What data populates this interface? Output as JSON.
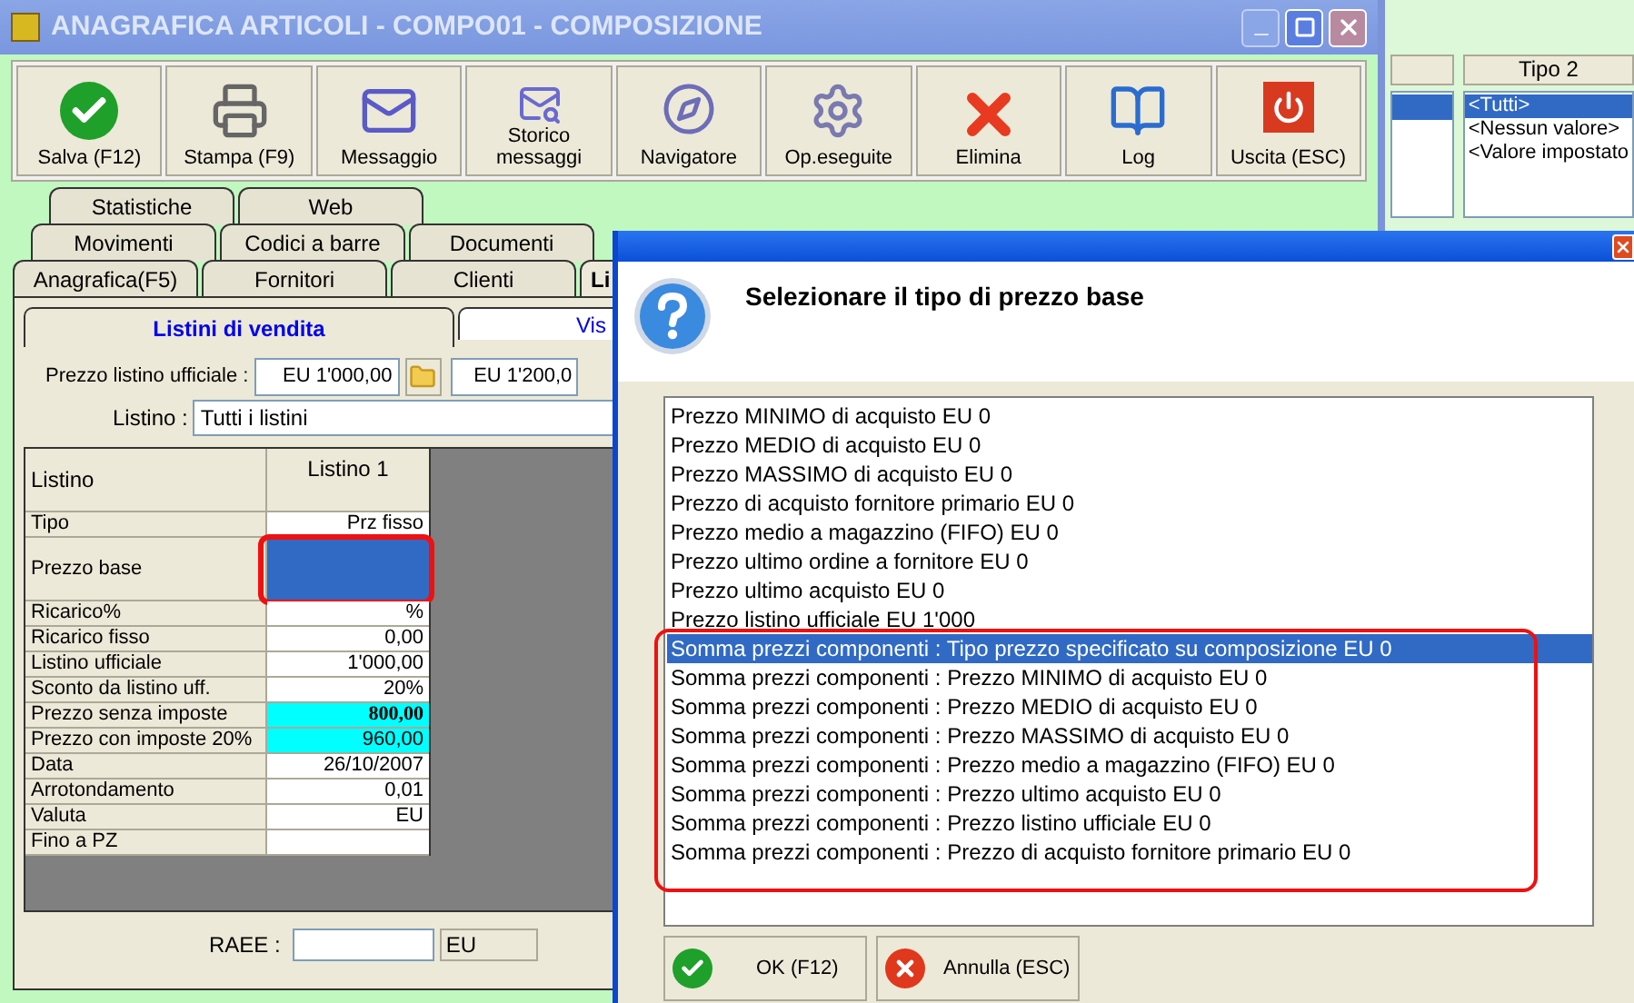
{
  "main_window": {
    "title": "ANAGRAFICA ARTICOLI - COMPO01 - COMPOSIZIONE"
  },
  "toolbar": [
    {
      "label": "Salva (F12)",
      "kind": "save"
    },
    {
      "label": "Stampa (F9)",
      "kind": "print"
    },
    {
      "label": "Messaggio",
      "kind": "message"
    },
    {
      "label": "Storico messaggi",
      "kind": "history"
    },
    {
      "label": "Navigatore",
      "kind": "navigator"
    },
    {
      "label": "Op.eseguite",
      "kind": "operations"
    },
    {
      "label": "Elimina",
      "kind": "delete"
    },
    {
      "label": "Log",
      "kind": "log"
    },
    {
      "label": "Uscita (ESC)",
      "kind": "exit"
    }
  ],
  "tab_rows": [
    {
      "tabs": [
        {
          "label": "Statistiche",
          "selected": false
        },
        {
          "label": "Web",
          "selected": false
        }
      ]
    },
    {
      "tabs": [
        {
          "label": "Movimenti",
          "selected": false
        },
        {
          "label": "Codici a barre",
          "selected": false
        },
        {
          "label": "Documenti",
          "selected": false
        }
      ]
    },
    {
      "tabs": [
        {
          "label": "Anagrafica(F5)",
          "selected": false
        },
        {
          "label": "Fornitori",
          "selected": false
        },
        {
          "label": "Clienti",
          "selected": false
        },
        {
          "label": "Li",
          "selected": true
        }
      ]
    }
  ],
  "subtabs": [
    {
      "label": "Listini di vendita",
      "selected": true
    },
    {
      "label": "Vis",
      "selected": false
    }
  ],
  "price_field": {
    "label": "Prezzo listino ufficiale :",
    "value": "EU 1'000,00",
    "value_2": "EU 1'200,0"
  },
  "listino_field": {
    "label": "Listino :",
    "value": "Tutti i listini"
  },
  "grid": {
    "header_label": "Listino",
    "column": "Listino 1",
    "rows": [
      {
        "label": "Tipo",
        "value": "Prz fisso",
        "kind": "text"
      },
      {
        "label": "Prezzo base",
        "value": "",
        "kind": "selected"
      },
      {
        "label": "Ricarico%",
        "value": "%",
        "kind": "text"
      },
      {
        "label": "Ricarico fisso",
        "value": "0,00",
        "kind": "text"
      },
      {
        "label": "Listino ufficiale",
        "value": "1'000,00",
        "kind": "text"
      },
      {
        "label": "Sconto da listino uff.",
        "value": "20%",
        "kind": "text"
      },
      {
        "label": "Prezzo senza imposte",
        "value": "800,00",
        "kind": "total_bold"
      },
      {
        "label": "Prezzo con imposte 20%",
        "value": "960,00",
        "kind": "total"
      },
      {
        "label": "Data",
        "value": "26/10/2007",
        "kind": "text"
      },
      {
        "label": "Arrotondamento",
        "value": "0,01",
        "kind": "text"
      },
      {
        "label": "Valuta",
        "value": "EU",
        "kind": "text"
      },
      {
        "label": "Fino a PZ",
        "value": "",
        "kind": "text"
      }
    ]
  },
  "raee": {
    "label": "RAEE :",
    "currency": "EU"
  },
  "background_window": {
    "column_1_selected": true,
    "column_2": "Tipo 2",
    "options": [
      {
        "label": "<Tutti>",
        "selected": true
      },
      {
        "label": "<Nessun valore>",
        "selected": false
      },
      {
        "label": "<Valore impostato",
        "selected": false
      }
    ]
  },
  "dialog": {
    "title": "Selezionare il tipo di prezzo base",
    "options": [
      {
        "label": "Prezzo MINIMO di acquisto EU 0",
        "kind": "own",
        "selected": false
      },
      {
        "label": "Prezzo MEDIO di acquisto EU 0",
        "kind": "own",
        "selected": false
      },
      {
        "label": "Prezzo MASSIMO di acquisto EU 0",
        "kind": "own",
        "selected": false
      },
      {
        "label": "Prezzo di acquisto fornitore primario EU 0",
        "kind": "own",
        "selected": false
      },
      {
        "label": "Prezzo medio a magazzino (FIFO) EU 0",
        "kind": "own",
        "selected": false
      },
      {
        "label": "Prezzo ultimo ordine a fornitore EU 0",
        "kind": "own",
        "selected": false
      },
      {
        "label": "Prezzo ultimo acquisto EU 0",
        "kind": "own",
        "selected": false
      },
      {
        "label": "Prezzo listino ufficiale EU 1'000",
        "kind": "own",
        "selected": false
      },
      {
        "label": "Somma prezzi componenti : Tipo prezzo specificato su composizione EU 0",
        "kind": "component",
        "selected": true
      },
      {
        "label": "Somma prezzi componenti : Prezzo MINIMO di acquisto EU 0",
        "kind": "component",
        "selected": false
      },
      {
        "label": "Somma prezzi componenti : Prezzo MEDIO di acquisto EU 0",
        "kind": "component",
        "selected": false
      },
      {
        "label": "Somma prezzi componenti : Prezzo MASSIMO di acquisto EU 0",
        "kind": "component",
        "selected": false
      },
      {
        "label": "Somma prezzi componenti : Prezzo medio a magazzino (FIFO) EU 0",
        "kind": "component",
        "selected": false
      },
      {
        "label": "Somma prezzi componenti : Prezzo ultimo acquisto EU 0",
        "kind": "component",
        "selected": false
      },
      {
        "label": "Somma prezzi componenti : Prezzo listino ufficiale EU 0",
        "kind": "component",
        "selected": false
      },
      {
        "label": "Somma prezzi componenti : Prezzo di acquisto fornitore primario EU 0",
        "kind": "component",
        "selected": false
      }
    ],
    "buttons": [
      {
        "label": "OK (F12)",
        "kind": "ok"
      },
      {
        "label": "Annulla (ESC)",
        "kind": "cancel"
      }
    ]
  }
}
